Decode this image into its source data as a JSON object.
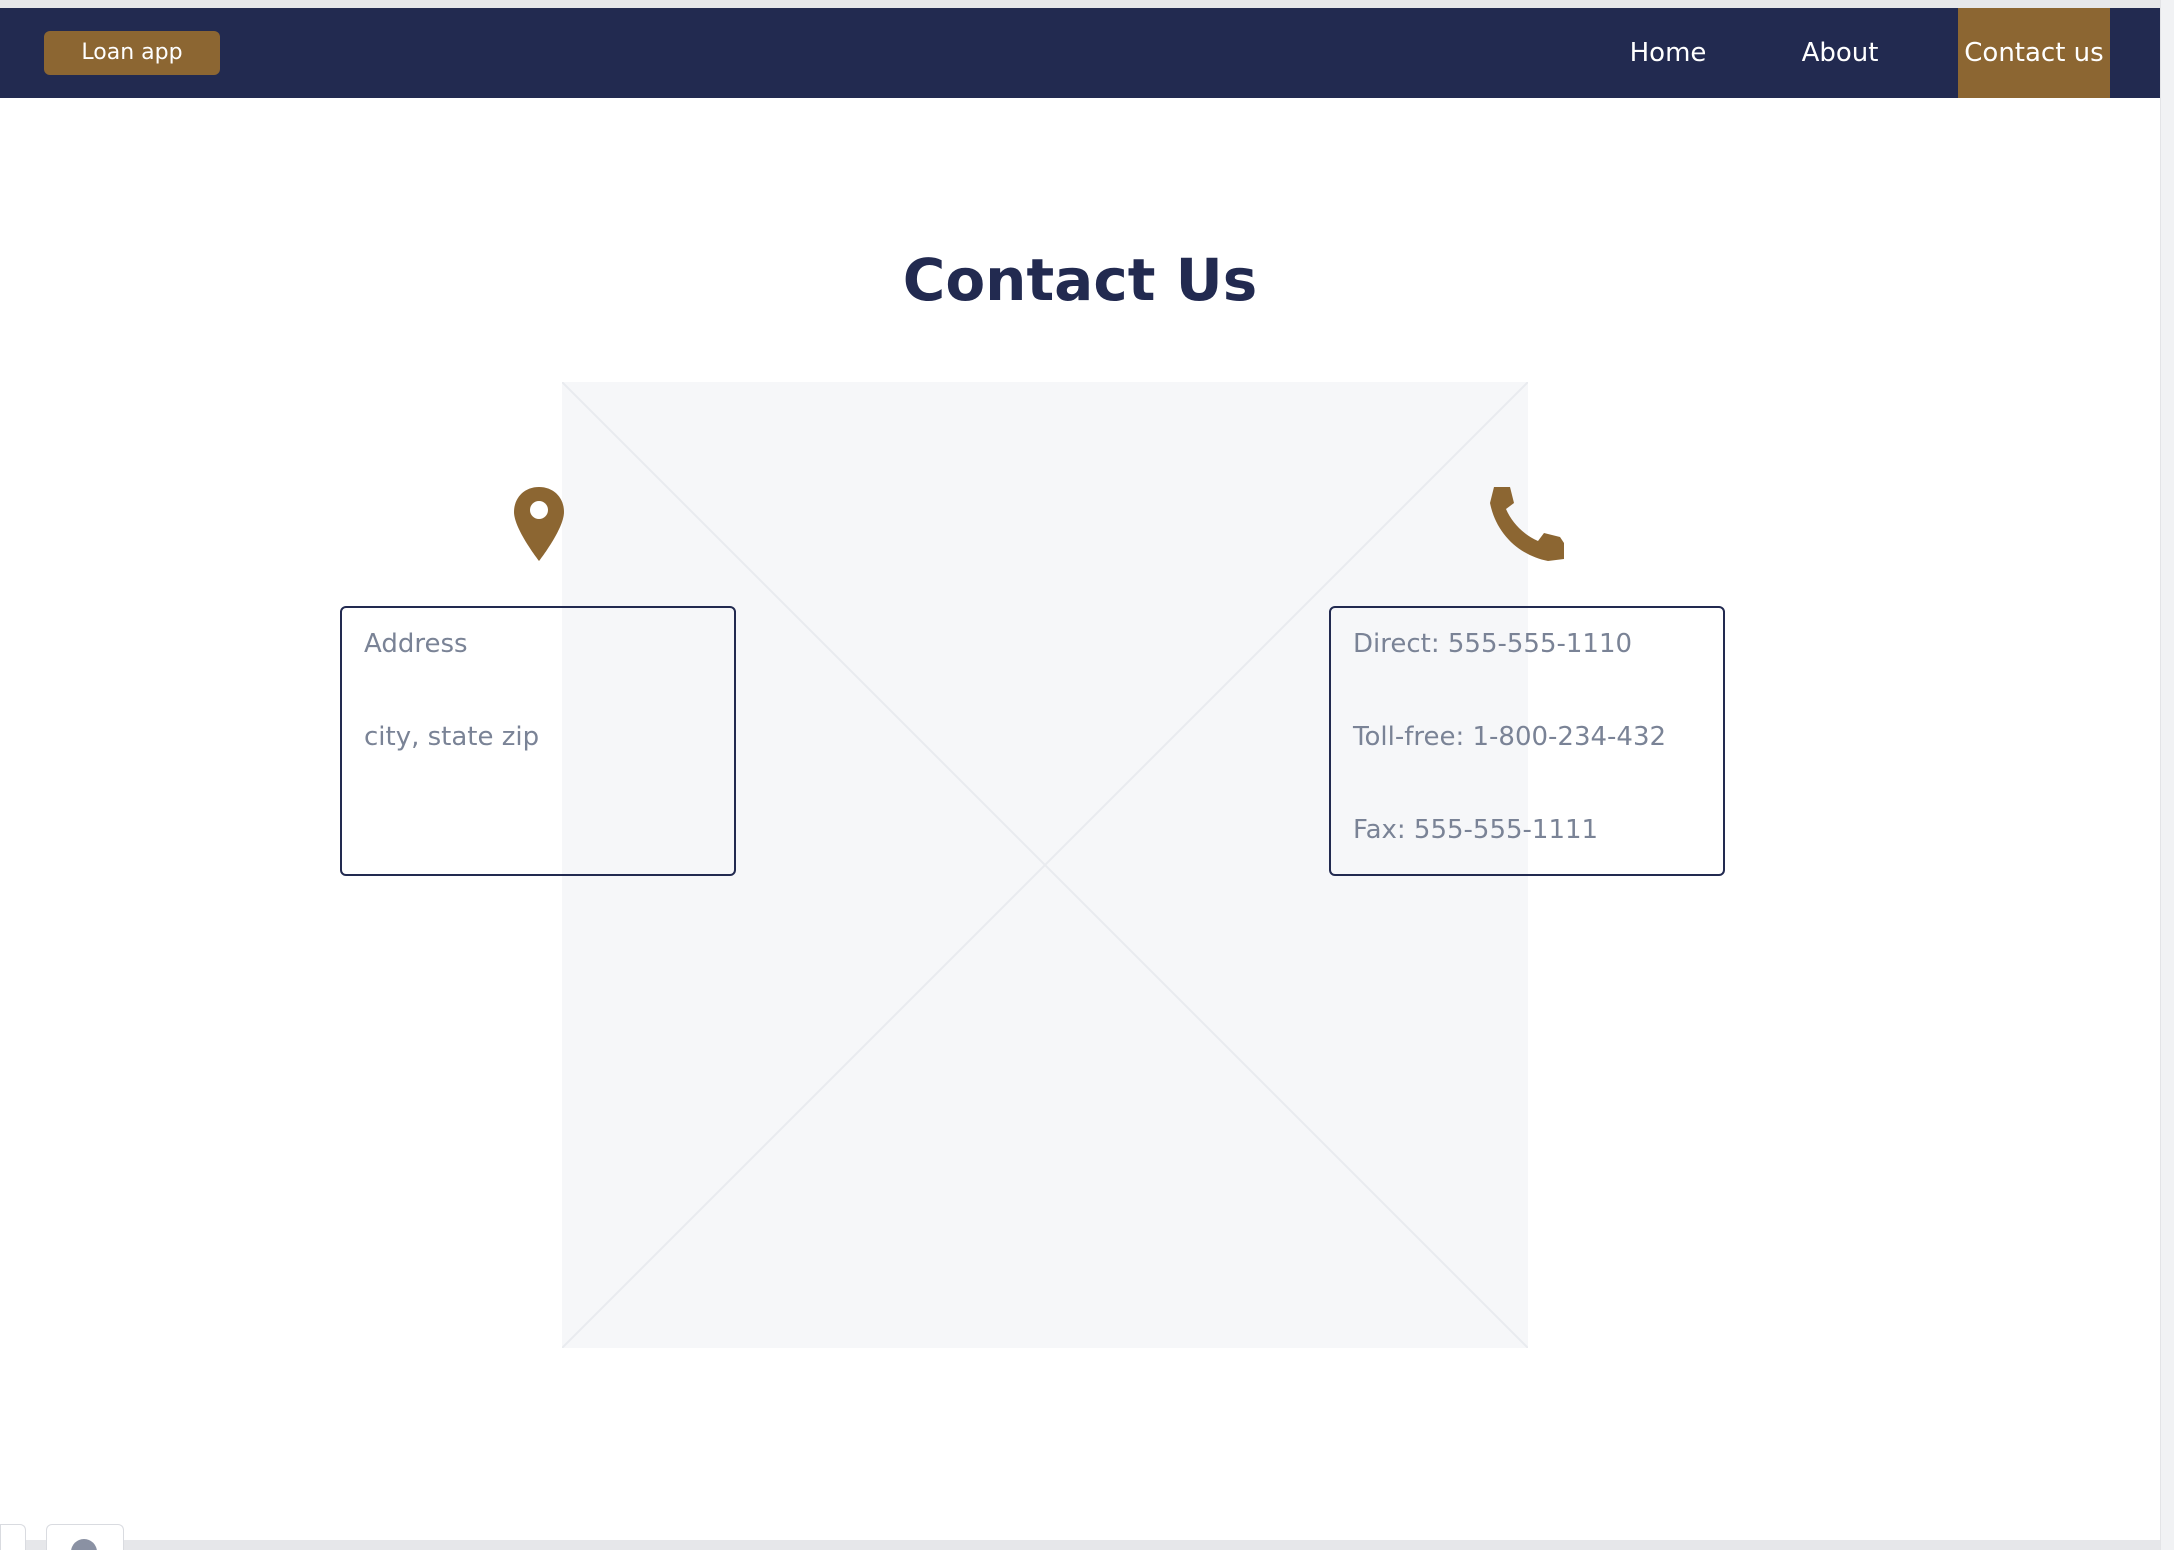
{
  "navbar": {
    "brand": "Loan app",
    "links": [
      {
        "label": "Home",
        "active": false
      },
      {
        "label": "About",
        "active": false
      },
      {
        "label": "Contact us",
        "active": true
      }
    ]
  },
  "page": {
    "title": "Contact Us"
  },
  "address_card": {
    "icon": "map-pin-icon",
    "lines": [
      "Address",
      "city, state zip"
    ]
  },
  "phone_card": {
    "icon": "phone-icon",
    "lines": [
      "Direct: 555-555-1110",
      "Toll-free: 1-800-234-432",
      "Fax: 555-555-1111"
    ]
  },
  "colors": {
    "navy": "#222a50",
    "gold": "#8c6632",
    "muted_text": "#7a8396",
    "placeholder_bg": "#f6f7f9"
  }
}
